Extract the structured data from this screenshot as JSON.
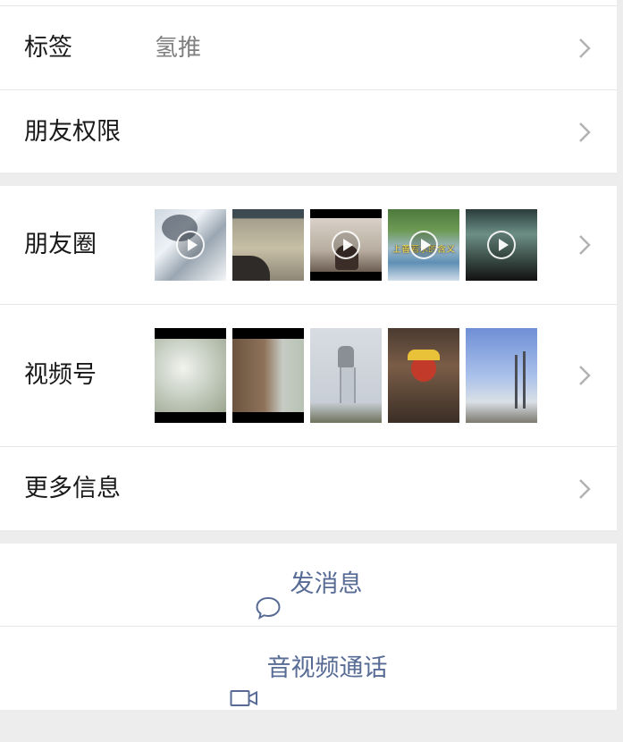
{
  "rows": {
    "tag": {
      "label": "标签",
      "value": "氢推"
    },
    "permissions": {
      "label": "朋友权限"
    },
    "moments": {
      "label": "朋友圈"
    },
    "channels": {
      "label": "视频号"
    },
    "more_info": {
      "label": "更多信息"
    }
  },
  "actions": {
    "message": {
      "label": "发消息",
      "icon": "chat-bubble-icon"
    },
    "call": {
      "label": "音视频通话",
      "icon": "video-camera-icon"
    }
  },
  "moments_thumbnails": [
    {
      "kind": "video"
    },
    {
      "kind": "image"
    },
    {
      "kind": "video"
    },
    {
      "kind": "video",
      "caption": "上善若水的含义"
    },
    {
      "kind": "video"
    }
  ],
  "channels_thumbnails": [
    {
      "kind": "image"
    },
    {
      "kind": "image"
    },
    {
      "kind": "image"
    },
    {
      "kind": "image"
    },
    {
      "kind": "image"
    }
  ],
  "colors": {
    "background": "#ededed",
    "card": "#ffffff",
    "link_blue": "#576b95",
    "secondary_text": "#7f7f7f",
    "chevron": "#b2b2b2"
  }
}
